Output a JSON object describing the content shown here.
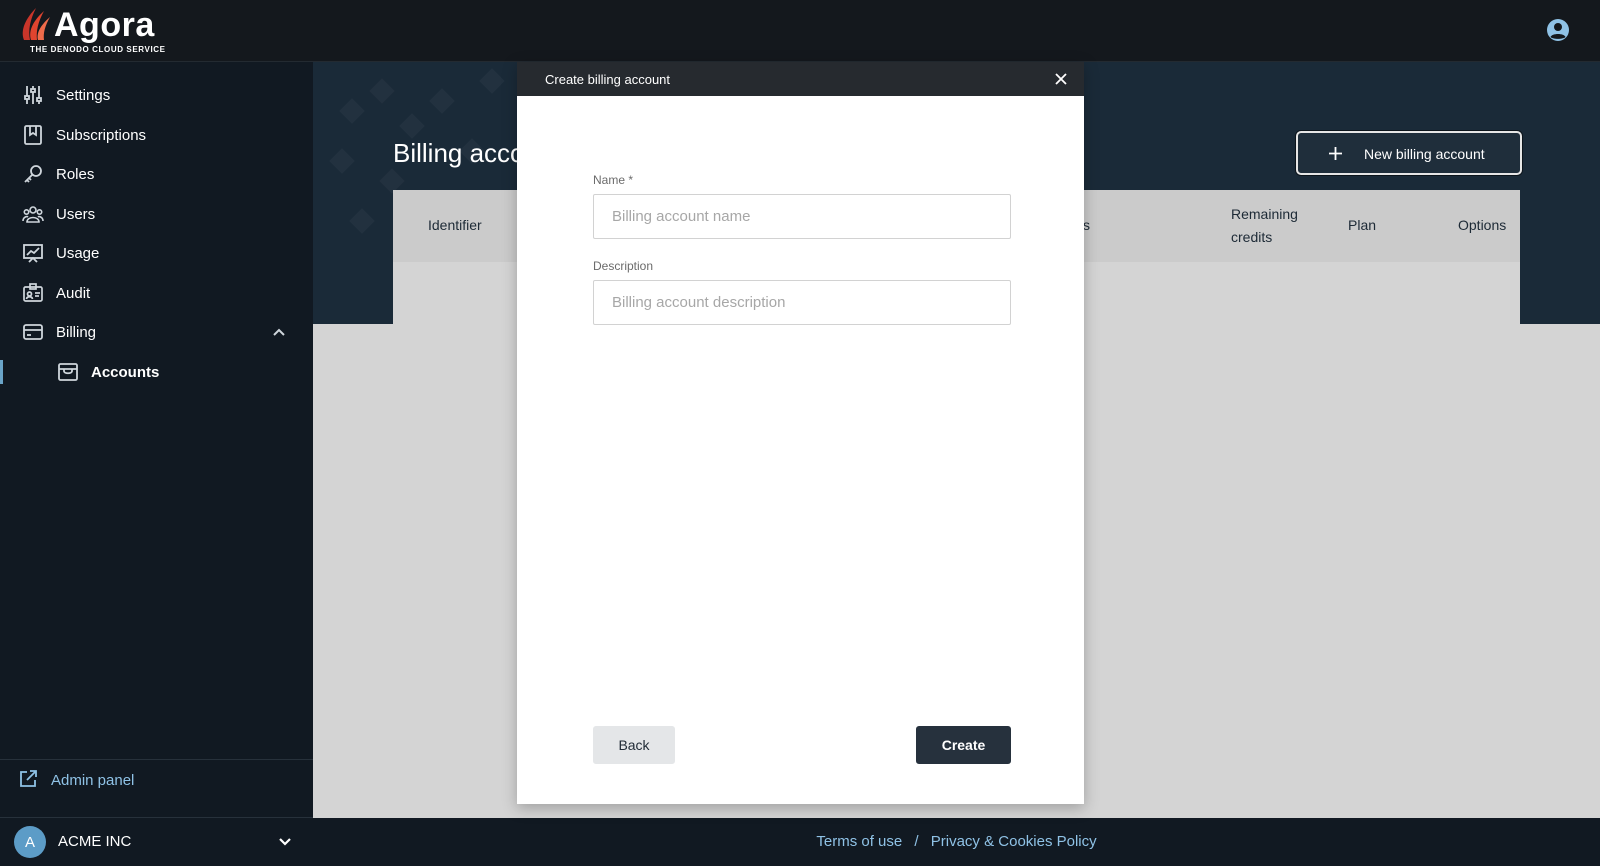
{
  "header": {
    "logo_text": "Agora",
    "logo_subtitle": "THE DENODO CLOUD SERVICE",
    "user_icon": "user-circle-icon"
  },
  "sidebar": {
    "items": [
      {
        "label": "Settings",
        "icon": "sliders-icon"
      },
      {
        "label": "Subscriptions",
        "icon": "bookmark-icon"
      },
      {
        "label": "Roles",
        "icon": "key-icon"
      },
      {
        "label": "Users",
        "icon": "users-icon"
      },
      {
        "label": "Usage",
        "icon": "chart-icon"
      },
      {
        "label": "Audit",
        "icon": "id-card-icon"
      },
      {
        "label": "Billing",
        "icon": "credit-card-icon",
        "expanded": true
      },
      {
        "label": "Accounts",
        "icon": "wallet-icon",
        "active": true
      }
    ],
    "admin_panel_label": "Admin panel",
    "org": {
      "initial": "A",
      "name": "ACME INC"
    }
  },
  "main": {
    "page_title": "Billing acco",
    "new_button_label": "New billing account",
    "table_headers": {
      "identifier": "Identifier",
      "partial": "s",
      "remaining_credits_line1": "Remaining",
      "remaining_credits_line2": "credits",
      "plan": "Plan",
      "options": "Options"
    }
  },
  "footer": {
    "terms": "Terms of use",
    "separator": "/",
    "privacy": "Privacy & Cookies Policy"
  },
  "modal": {
    "title": "Create billing account",
    "name_label": "Name *",
    "name_placeholder": "Billing account name",
    "name_value": "",
    "description_label": "Description",
    "description_placeholder": "Billing account description",
    "description_value": "",
    "back_label": "Back",
    "create_label": "Create"
  },
  "colors": {
    "topbar": "#14181d",
    "sidebar": "#111922",
    "link": "#8fc2e6",
    "primary_button": "#26313d",
    "logo_accent": "#d9392b"
  }
}
